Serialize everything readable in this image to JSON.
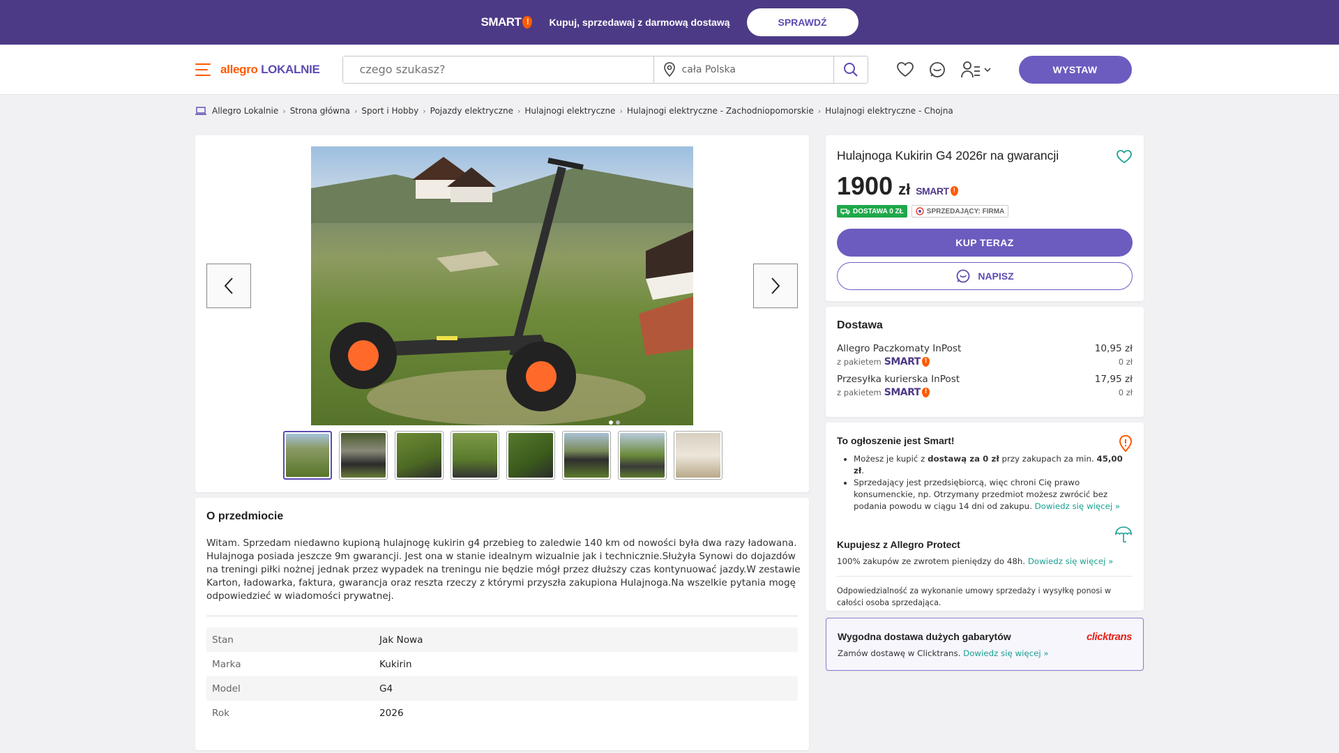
{
  "topbar": {
    "smart_label": "SMART",
    "promo": "Kupuj, sprzedawaj z darmową dostawą",
    "button": "SPRAWDŹ"
  },
  "header": {
    "brand_a": "allegro",
    "brand_b": "LOKALNIE",
    "search_placeholder": "czego szukasz?",
    "location_value": "cała Polska",
    "post_button": "WYSTAW"
  },
  "breadcrumbs": [
    "Allegro Lokalnie",
    "Strona główna",
    "Sport i Hobby",
    "Pojazdy elektryczne",
    "Hulajnogi elektryczne",
    "Hulajnogi elektryczne - Zachodniopomorskie",
    "Hulajnogi elektryczne - Chojna"
  ],
  "listing": {
    "title": "Hulajnoga Kukirin G4 2026r na gwarancji",
    "price": "1900",
    "currency": "zł",
    "badge_delivery": "DOSTAWA 0 ZŁ",
    "badge_seller": "SPRZEDAJĄCY: FIRMA",
    "buy_button": "KUP TERAZ",
    "message_button": "NAPISZ"
  },
  "delivery": {
    "heading": "Dostawa",
    "with_package": "z pakietem",
    "options": [
      {
        "name": "Allegro Paczkomaty InPost",
        "price": "10,95 zł",
        "smart_price": "0 zł"
      },
      {
        "name": "Przesyłka kurierska InPost",
        "price": "17,95 zł",
        "smart_price": "0 zł"
      }
    ]
  },
  "smart_info": {
    "heading": "To ogłoszenie jest Smart!",
    "b1_pre": "Możesz je kupić z ",
    "b1_bold": "dostawą za 0 zł",
    "b1_mid": " przy zakupach za min. ",
    "b1_amount": "45,00 zł",
    "b1_end": ".",
    "b2_text": "Sprzedający jest przedsiębiorcą, więc chroni Cię prawo konsumenckie, np. Otrzymany przedmiot możesz zwrócić bez podania powodu w ciągu 14 dni od zakupu. ",
    "learn_more": "Dowiedz się więcej »",
    "protect_heading": "Kupujesz z Allegro Protect",
    "protect_text": "100% zakupów ze zwrotem pieniędzy do 48h. ",
    "responsibility": "Odpowiedzialność za wykonanie umowy sprzedaży i wysyłkę ponosi w całości osoba sprzedająca."
  },
  "clicktrans": {
    "heading": "Wygodna dostawa dużych gabarytów",
    "text": "Zamów dostawę w Clicktrans. ",
    "link": "Dowiedz się więcej »",
    "brand": "clicktrans"
  },
  "about": {
    "heading": "O przedmiocie",
    "description": "Witam. Sprzedam niedawno kupioną hulajnogę kukirin g4 przebieg to zaledwie 140 km od nowości była dwa razy ładowana. Hulajnoga posiada jeszcze 9m gwarancji. Jest ona w stanie idealnym wizualnie jak i technicznie.Służyła Synowi do dojazdów na treningi piłki nożnej jednak przez wypadek na treningu nie będzie mógł przez dłuższy czas kontynuować jazdy.W zestawie Karton, ładowarka, faktura, gwarancja oraz reszta rzeczy z którymi przyszła zakupiona Hulajnoga.Na wszelkie pytania mogę odpowiedzieć w wiadomości prywatnej.",
    "params": [
      {
        "key": "Stan",
        "value": "Jak Nowa"
      },
      {
        "key": "Marka",
        "value": "Kukirin"
      },
      {
        "key": "Model",
        "value": "G4"
      },
      {
        "key": "Rok",
        "value": "2026"
      }
    ]
  },
  "colors": {
    "topbar": "#4d3a86",
    "accent": "#6c5cbf",
    "brand_orange": "#ff5a00",
    "link": "#1aa090",
    "badge_green": "#1fa84a"
  }
}
